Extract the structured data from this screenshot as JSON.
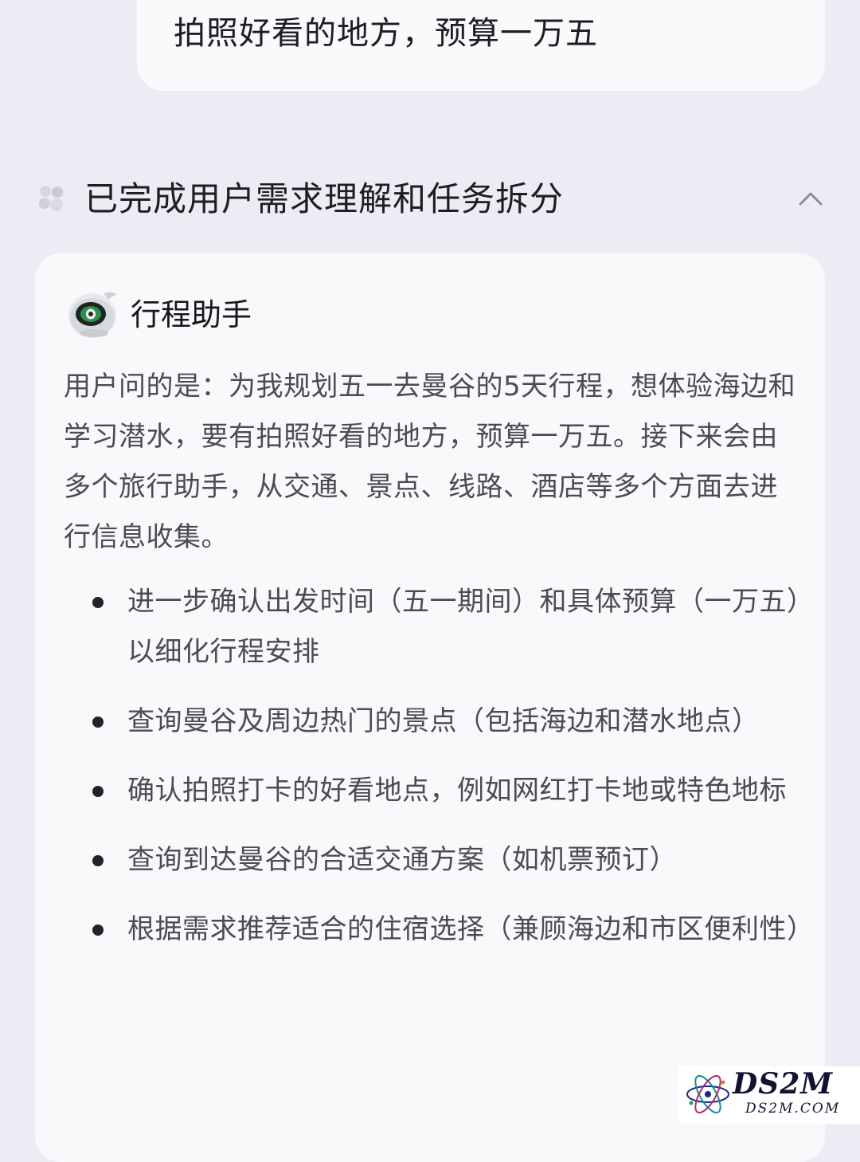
{
  "user_message": {
    "text": "拍照好看的地方，预算一万五"
  },
  "status": {
    "text": "已完成用户需求理解和任务拆分",
    "icon": "sparkle-cluster-icon",
    "toggle_icon": "chevron-up-icon"
  },
  "card": {
    "agent_name": "行程助手",
    "agent_avatar": "robot-avatar-icon",
    "summary": "用户问的是：为我规划五一去曼谷的5天行程，想体验海边和学习潜水，要有拍照好看的地方，预算一万五。接下来会由多个旅行助手，从交通、景点、线路、酒店等多个方面去进行信息收集。",
    "tasks": [
      "进一步确认出发时间（五一期间）和具体预算（一万五）以细化行程安排",
      "查询曼谷及周边热门的景点（包括海边和潜水地点）",
      "确认拍照打卡的好看地点，例如网红打卡地或特色地标",
      "查询到达曼谷的合适交通方案（如机票预订）",
      "根据需求推荐适合的住宿选择（兼顾海边和市区便利性）"
    ]
  },
  "watermark": {
    "brand": "DS2M",
    "domain": "DS2M.COM"
  },
  "colors": {
    "page_background": "#ebecf4",
    "card_background": "#f9f9fc",
    "body_text": "#4b4b54",
    "heading_text": "#1d1d22"
  }
}
